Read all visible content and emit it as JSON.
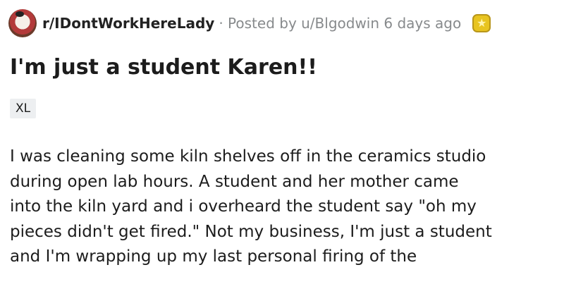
{
  "post": {
    "subreddit": "r/IDontWorkHereLady",
    "meta": "· Posted by u/Blgodwin 6 days ago",
    "award_icon": "star-award-icon",
    "title": "I'm just a student Karen!!",
    "flair": "XL",
    "body_lines": [
      "I was cleaning some kiln shelves off in the ceramics studio",
      "during open lab hours. A student and her mother came",
      "into the kiln yard and i overheard the student say \"oh my",
      "pieces didn't get fired.\" Not my business, I'm just a student",
      "and I'm wrapping up my last personal firing of the"
    ]
  }
}
